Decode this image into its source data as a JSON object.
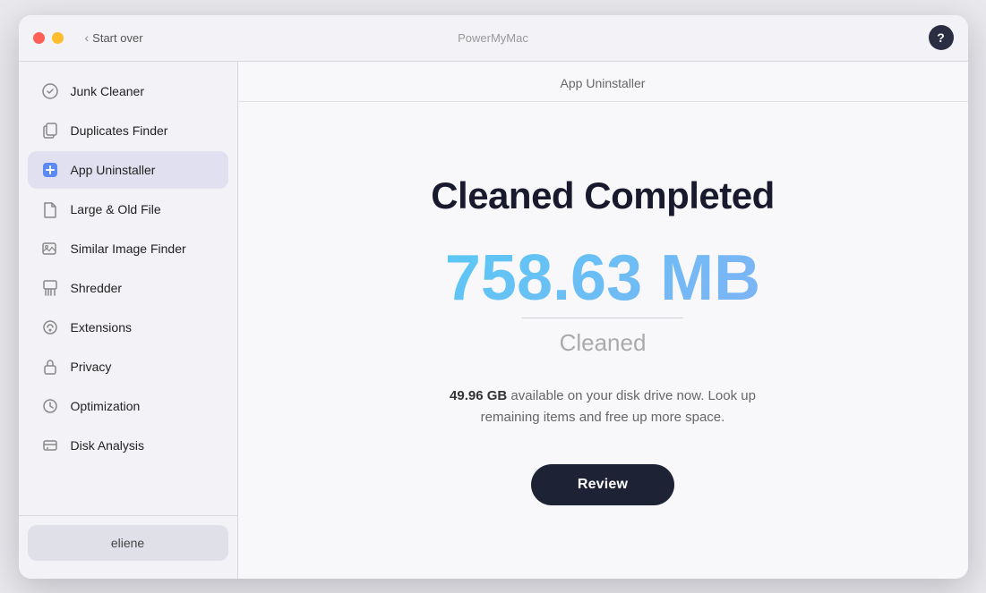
{
  "titleBar": {
    "appName": "PowerMyMac",
    "startOverLabel": "Start over",
    "helpLabel": "?"
  },
  "contentHeader": {
    "title": "App Uninstaller"
  },
  "sidebar": {
    "items": [
      {
        "id": "junk-cleaner",
        "label": "Junk Cleaner",
        "icon": "gear"
      },
      {
        "id": "duplicates-finder",
        "label": "Duplicates Finder",
        "icon": "folder"
      },
      {
        "id": "app-uninstaller",
        "label": "App Uninstaller",
        "icon": "app",
        "active": true
      },
      {
        "id": "large-old-file",
        "label": "Large & Old File",
        "icon": "file"
      },
      {
        "id": "similar-image-finder",
        "label": "Similar Image Finder",
        "icon": "image"
      },
      {
        "id": "shredder",
        "label": "Shredder",
        "icon": "shred"
      },
      {
        "id": "extensions",
        "label": "Extensions",
        "icon": "ext"
      },
      {
        "id": "privacy",
        "label": "Privacy",
        "icon": "lock"
      },
      {
        "id": "optimization",
        "label": "Optimization",
        "icon": "opt"
      },
      {
        "id": "disk-analysis",
        "label": "Disk Analysis",
        "icon": "disk"
      }
    ],
    "footer": {
      "username": "eliene"
    }
  },
  "main": {
    "cleanedTitle": "Cleaned Completed",
    "sizeValue": "758.63 MB",
    "cleanedLabel": "Cleaned",
    "availableGB": "49.96 GB",
    "availableText": " available on your disk drive now. Look up remaining items and free up more space.",
    "reviewButtonLabel": "Review"
  }
}
